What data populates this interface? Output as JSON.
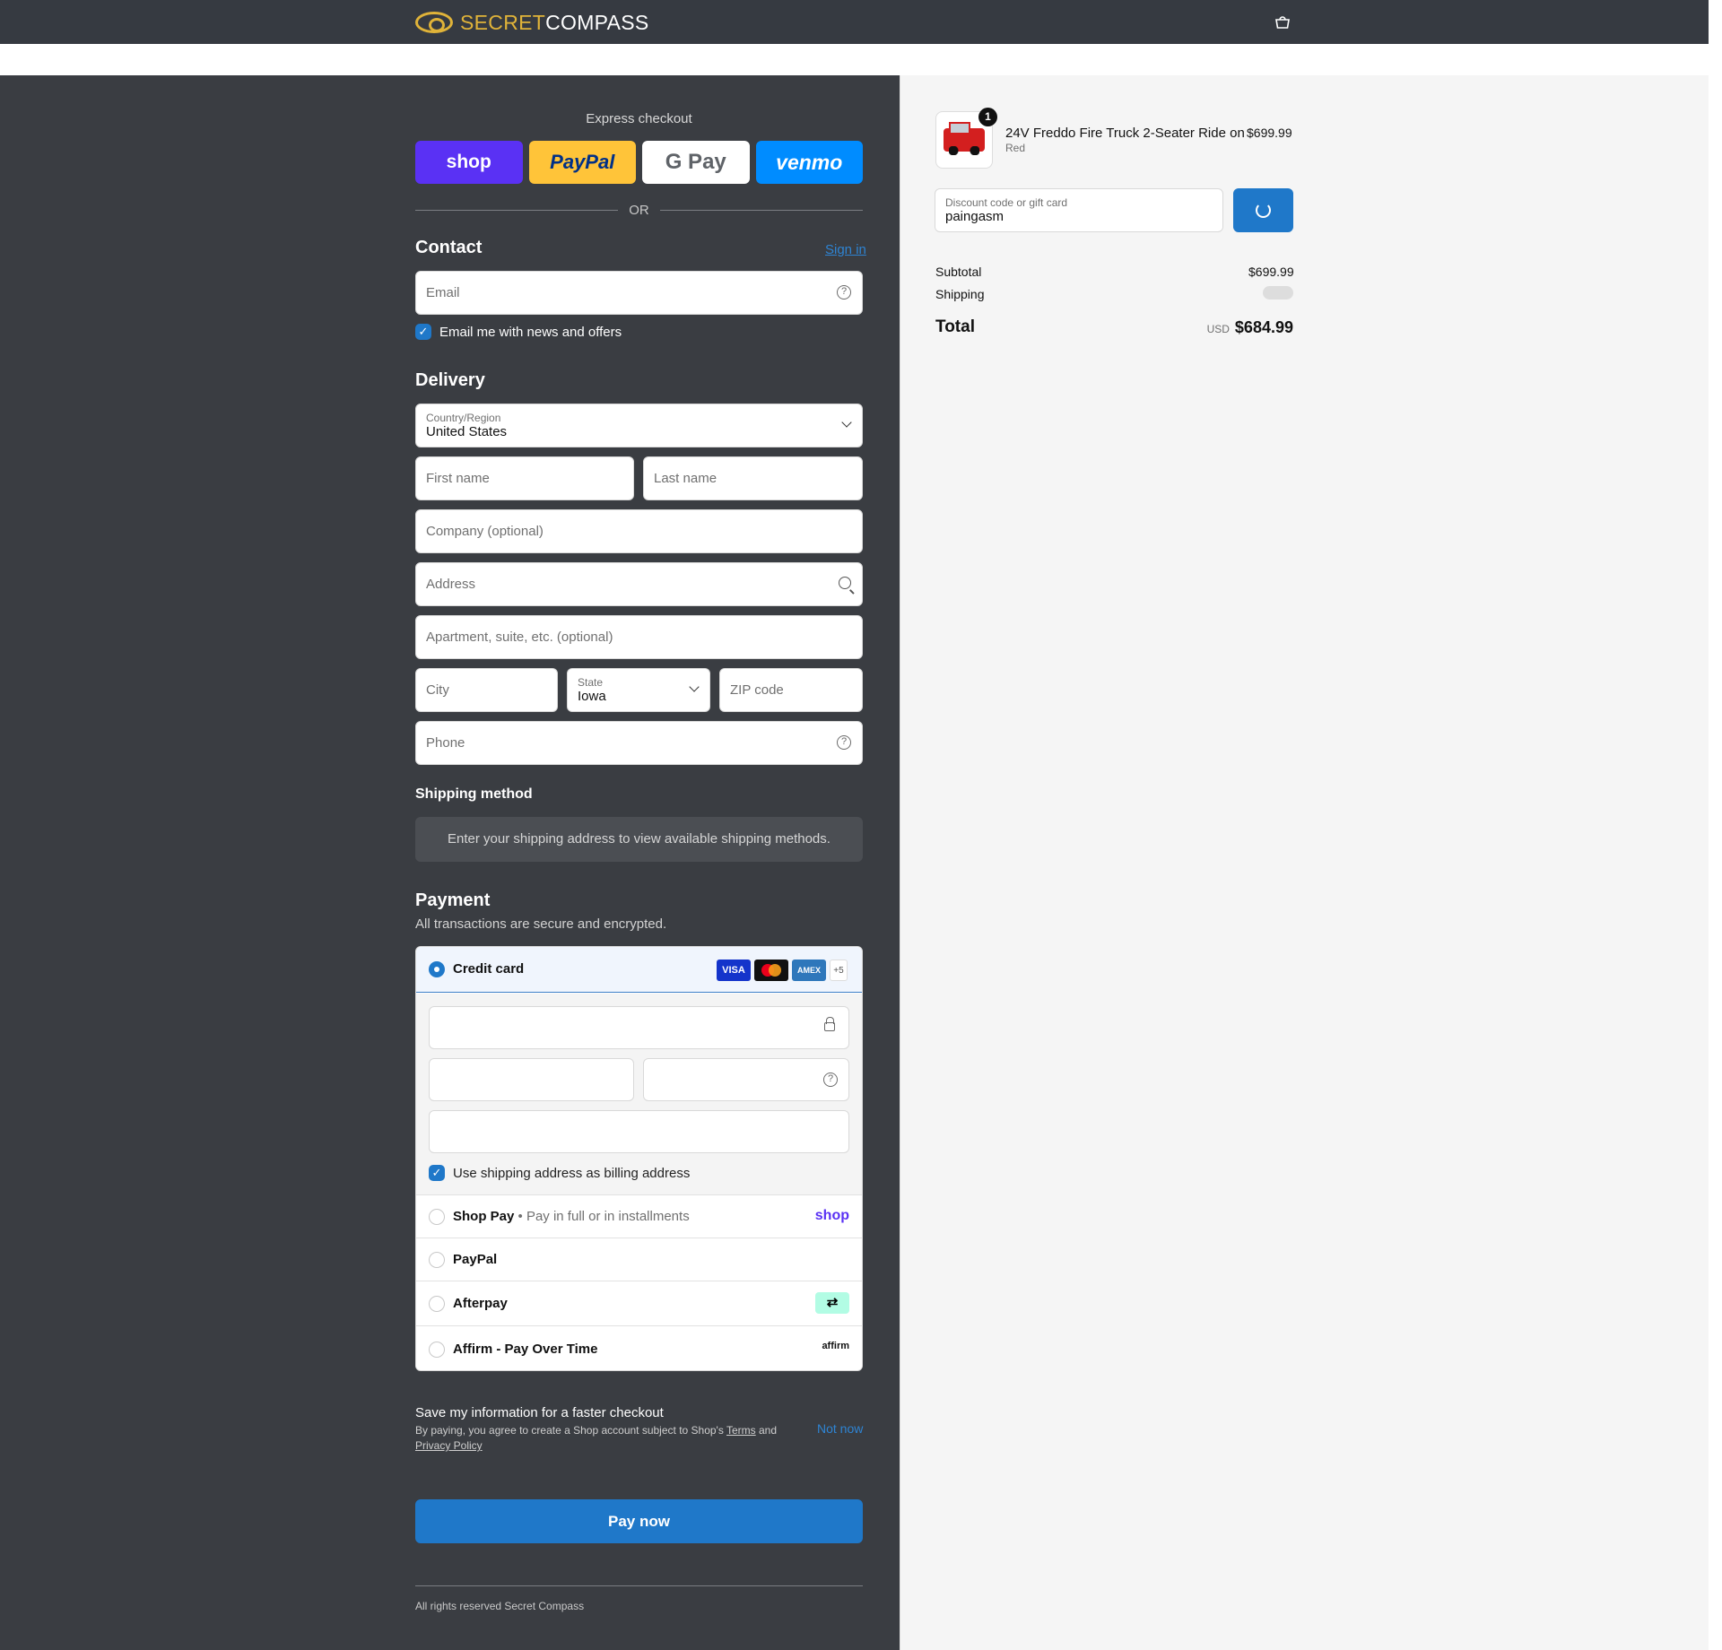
{
  "brand": {
    "name_part1": "SECRET",
    "name_part2": "COMPASS",
    "accent": "#e0b339"
  },
  "header": {
    "bag_icon": "bag-icon"
  },
  "express": {
    "title": "Express checkout",
    "buttons": {
      "shop": "shop",
      "paypal": "PayPal",
      "gpay": "G Pay",
      "venmo": "venmo"
    },
    "or": "OR"
  },
  "contact": {
    "title": "Contact",
    "sign_in": "Sign in",
    "email_placeholder": "Email",
    "news_label": "Email me with news and offers"
  },
  "delivery": {
    "title": "Delivery",
    "country_label": "Country/Region",
    "country_value": "United States",
    "first_name": "First name",
    "last_name": "Last name",
    "company": "Company (optional)",
    "address": "Address",
    "apartment": "Apartment, suite, etc. (optional)",
    "city": "City",
    "state_label": "State",
    "state_value": "Iowa",
    "zip": "ZIP code",
    "phone": "Phone"
  },
  "shipping_method": {
    "title": "Shipping method",
    "note": "Enter your shipping address to view available shipping methods."
  },
  "payment": {
    "title": "Payment",
    "subtitle": "All transactions are secure and encrypted.",
    "credit_card": "Credit card",
    "card_logos": {
      "visa": "VISA",
      "amex": "AMEX",
      "more": "+5"
    },
    "billing_label": "Use shipping address as billing address",
    "shop_pay": "Shop Pay",
    "shop_pay_sub": "• Pay in full or in installments",
    "shop_logo": "shop",
    "paypal": "PayPal",
    "afterpay": "Afterpay",
    "affirm": "Affirm - Pay Over Time",
    "affirm_logo": "affirm"
  },
  "save": {
    "title": "Save my information for a faster checkout",
    "sub_prefix": "By paying, you agree to create a Shop account subject to Shop's",
    "terms": "Terms",
    "and": "and",
    "privacy": "Privacy Policy",
    "not_now": "Not now"
  },
  "pay_now": "Pay now",
  "footer": "All rights reserved Secret Compass",
  "order": {
    "quantity": "1",
    "product_name": "24V Freddo Fire Truck 2-Seater Ride on",
    "variant": "Red",
    "price": "$699.99",
    "discount_label": "Discount code or gift card",
    "discount_value": "paingasm",
    "subtotal_label": "Subtotal",
    "subtotal_value": "$699.99",
    "shipping_label": "Shipping",
    "total_label": "Total",
    "currency": "USD",
    "total_value": "$684.99"
  },
  "colors": {
    "primary": "#1f78c9",
    "dark_bg": "#3a3d42",
    "topbar": "#363a41"
  }
}
